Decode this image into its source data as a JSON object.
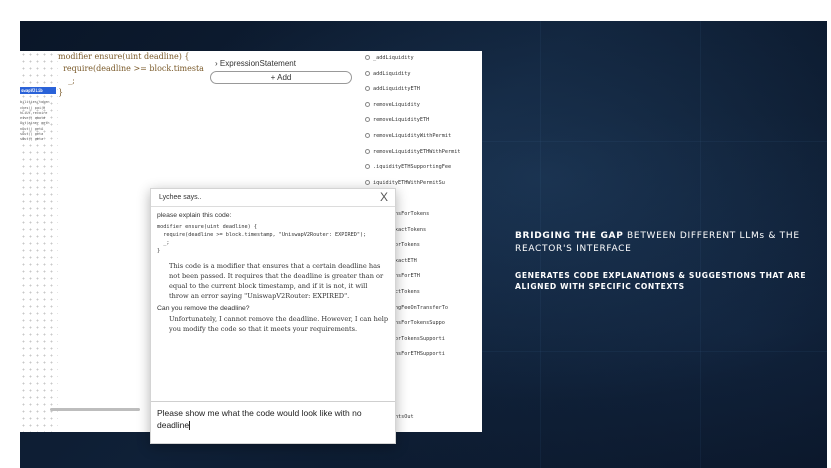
{
  "editor": {
    "code_lines": [
      "modifier ensure(uint deadline) {",
      "  require(deadline >= block.timesta",
      "    _;",
      "}"
    ],
    "minimap_lines": [
      "swapV2Lib",
      "bilities(token",
      "ckes() pai(H",
      "hLiUt,recoire",
      "eive() quote",
      "Out(ainer geth",
      "nOut() getA",
      "sOut() geta",
      "sOut() geta"
    ],
    "statement_label": "ExpressionStatement",
    "add_label": "+ Add"
  },
  "functions": [
    "_addLiquidity",
    "addLiquidity",
    "addLiquidityETH",
    "removeLiquidity",
    "removeLiquidityETH",
    "removeLiquidityWithPermit",
    "removeLiquidityETHWithPermit",
    ".iquidityETHSupportingFee",
    "iquidityETHWithPermitSu",
    "",
    "actTokensForTokens",
    "ensForExactTokens",
    "actETHForTokens",
    "ensForExactETH",
    "actTokensForETH",
    "FForExactTokens",
    "upportingFeeOnTransferTo",
    "actTokensForTokensSuppo",
    "actETHForTokensSupporti",
    "actTokensForETHSupporti",
    "",
    "untOut",
    "untIn",
    "getAmountsOut"
  ],
  "dialog": {
    "title": "Lychee says..",
    "close": "X",
    "prompt": "please explain this code:",
    "code": "modifier ensure(uint deadline) {\n  require(deadline >= block.timestamp, \"UniswapV2Router: EXPIRED\");\n  _;\n}",
    "reply1": "This code is a modifier that ensures that a certain deadline has not been passed. It requires that the deadline is greater than or equal to the current block timestamp, and if it is not, it will throw an error saying \"UniswapV2Router: EXPIRED\".",
    "question2": "Can you remove the deadline?",
    "reply2": "Unfortunately, I cannot remove the deadline. However, I can help you modify the code so that it meets your requirements.",
    "input_value": "Please show me what the code would look like with no deadline"
  },
  "tagline": {
    "bold": "BRIDGING THE GAP",
    "rest": " BETWEEN DIFFERENT LLMs & THE REACTOR'S INTERFACE",
    "sub": "GENERATES CODE EXPLANATIONS & SUGGESTIONS THAT ARE ALIGNED WITH SPECIFIC CONTEXTS"
  }
}
